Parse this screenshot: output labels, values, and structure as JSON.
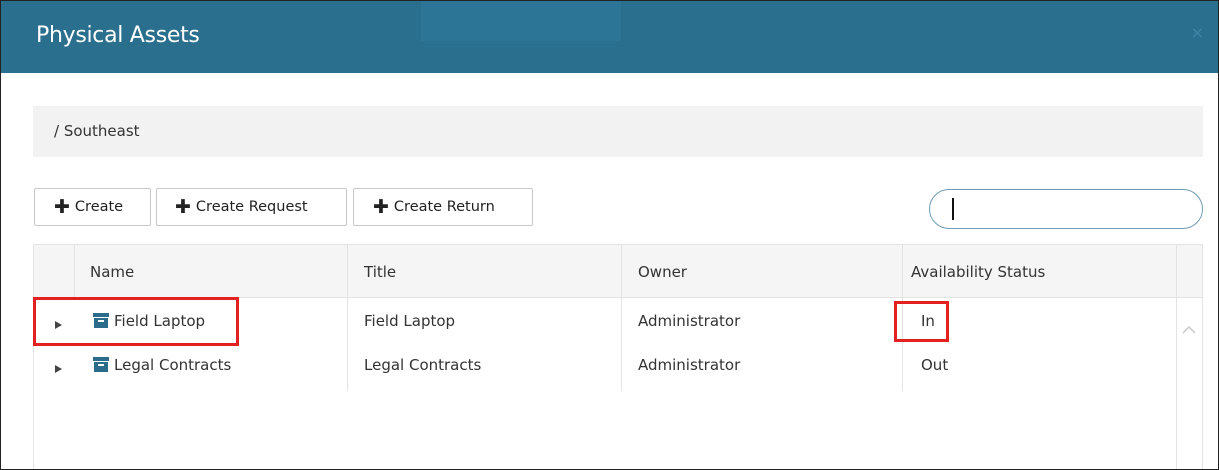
{
  "window": {
    "title": "Physical Assets",
    "close_icon": "×"
  },
  "breadcrumb": {
    "path": "/ Southeast"
  },
  "toolbar": {
    "create_label": "Create",
    "create_request_label": "Create Request",
    "create_return_label": "Create Return",
    "plus_glyph": "✚"
  },
  "search": {
    "value": "",
    "placeholder": ""
  },
  "table": {
    "columns": [
      "Name",
      "Title",
      "Owner",
      "Availability Status"
    ],
    "rows": [
      {
        "name": "Field Laptop",
        "title": "Field Laptop",
        "owner": "Administrator",
        "status": "In"
      },
      {
        "name": "Legal Contracts",
        "title": "Legal Contracts",
        "owner": "Administrator",
        "status": "Out"
      }
    ]
  },
  "colors": {
    "header_bg": "#2b6f8e",
    "highlight": "#e32121",
    "item_icon": "#2a6c8a"
  },
  "icons": {
    "row_icon": "archive-box-icon",
    "expander": "triangle-right-icon",
    "scroll": "chevron-up-icon"
  }
}
